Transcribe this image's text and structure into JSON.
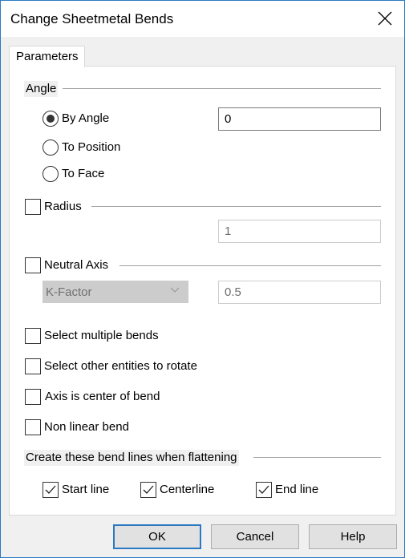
{
  "window": {
    "title": "Change Sheetmetal Bends",
    "close_icon": "close-x"
  },
  "tabs": [
    {
      "label": "Parameters",
      "active": true
    }
  ],
  "angle_group": {
    "label": "Angle",
    "options": [
      {
        "label": "By Angle",
        "selected": true
      },
      {
        "label": "To Position",
        "selected": false
      },
      {
        "label": "To Face",
        "selected": false
      }
    ],
    "value": "0"
  },
  "radius_group": {
    "label": "Radius",
    "checked": false,
    "value": "1"
  },
  "neutral_axis_group": {
    "label": "Neutral Axis",
    "checked": false,
    "type_selected": "K-Factor",
    "value": "0.5"
  },
  "options": [
    {
      "label": "Select multiple bends",
      "checked": false
    },
    {
      "label": "Select other entities to rotate",
      "checked": false
    },
    {
      "label": "Axis is center of bend",
      "checked": false
    },
    {
      "label": "Non linear bend",
      "checked": false
    }
  ],
  "bend_lines_group": {
    "label": "Create these bend lines when flattening",
    "items": [
      {
        "label": "Start line",
        "checked": true
      },
      {
        "label": "Centerline",
        "checked": true
      },
      {
        "label": "End line",
        "checked": true
      }
    ]
  },
  "buttons": {
    "ok": "OK",
    "cancel": "Cancel",
    "help": "Help"
  },
  "colors": {
    "accent": "#2b79c2",
    "dialog_bg": "#f0f0f0",
    "disabled_bg": "#cccccc"
  }
}
